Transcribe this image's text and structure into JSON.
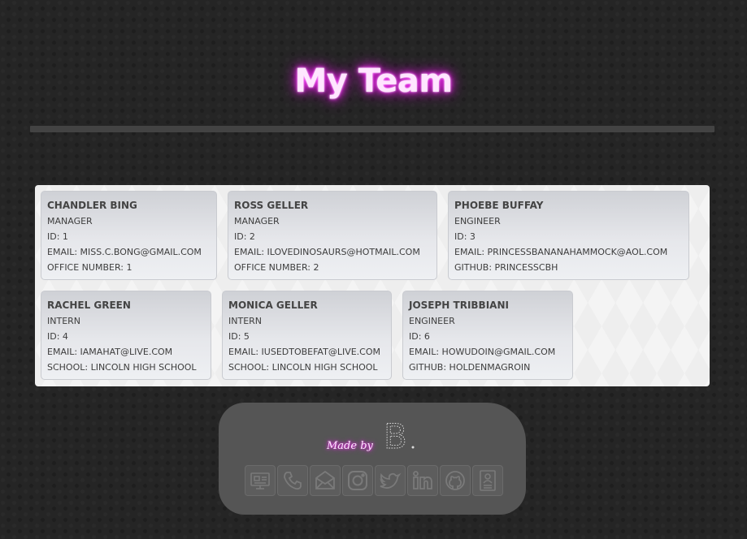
{
  "header": {
    "title": "My Team"
  },
  "team": [
    {
      "name": "Chandler Bing",
      "role": "Manager",
      "id_line": "ID: 1",
      "email_line": "Email: miss.c.bong@gmail.com",
      "extra_line": "Office Number: 1"
    },
    {
      "name": "Ross Geller",
      "role": "Manager",
      "id_line": "ID: 2",
      "email_line": "Email: ilovedinosaurs@hotmail.com",
      "extra_line": "Office Number: 2"
    },
    {
      "name": "Phoebe Buffay",
      "role": "Engineer",
      "id_line": "ID: 3",
      "email_line": "Email: princessbananahammock@aol.com",
      "extra_line": "Github: princesscbh"
    },
    {
      "name": "Rachel Green",
      "role": "Intern",
      "id_line": "ID: 4",
      "email_line": "Email: iamahat@live.com",
      "extra_line": "School: Lincoln High School"
    },
    {
      "name": "Monica Geller",
      "role": "Intern",
      "id_line": "ID: 5",
      "email_line": "Email: iusedtobefat@live.com",
      "extra_line": "School: Lincoln High School"
    },
    {
      "name": "Joseph Tribbiani",
      "role": "Engineer",
      "id_line": "ID: 6",
      "email_line": "Email: howudoin@gmail.com",
      "extra_line": "Github: holdenmagroin"
    }
  ],
  "footer": {
    "made_by": "Made by",
    "logo_letter": "B",
    "icons": [
      "portfolio-icon",
      "phone-icon",
      "email-icon",
      "instagram-icon",
      "twitter-icon",
      "linkedin-icon",
      "github-icon",
      "resume-icon"
    ]
  },
  "colors": {
    "neon": "#ff33ff",
    "background": "#252525",
    "panel": "#f4f4f4",
    "footer": "#555555"
  }
}
